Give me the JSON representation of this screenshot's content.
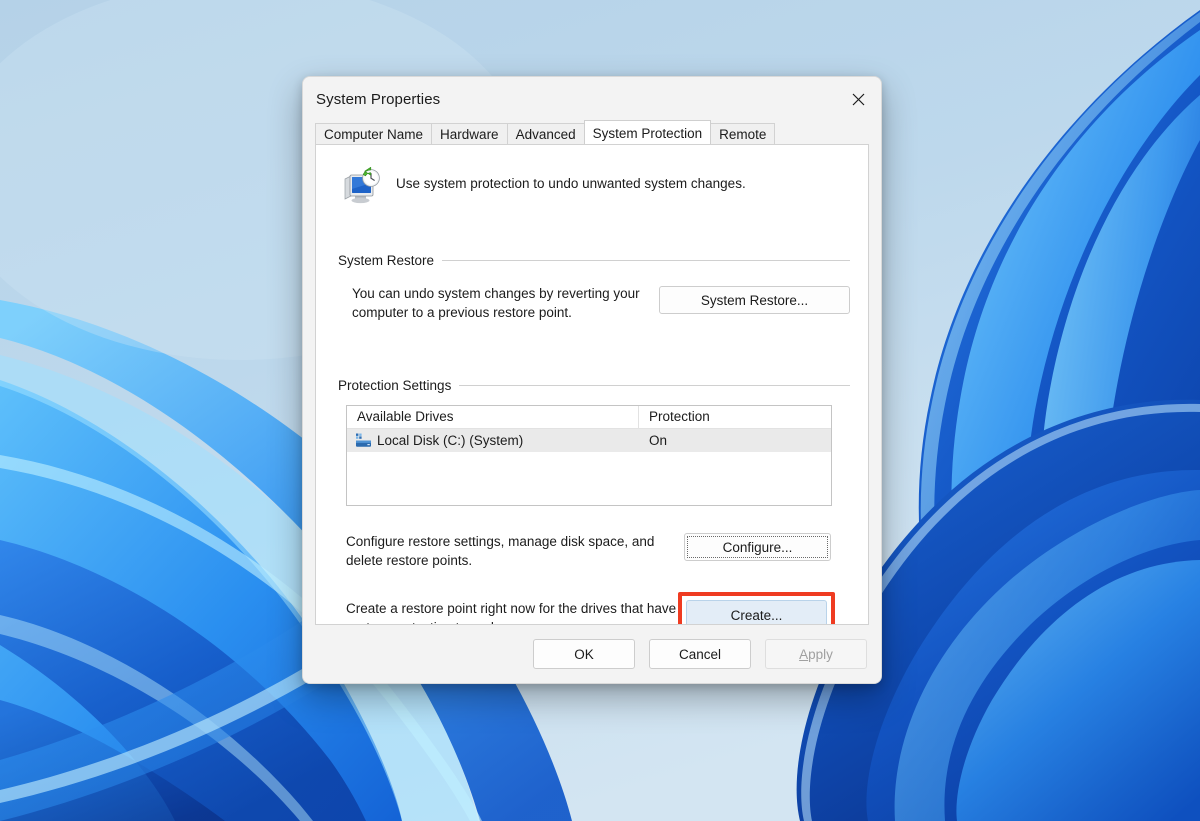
{
  "wallpaper": {
    "name": "windows-11-bloom",
    "base_color": "#b9d5ea"
  },
  "dialog": {
    "title": "System Properties",
    "close_icon": "close-icon",
    "tabs": [
      {
        "label": "Computer Name",
        "active": false
      },
      {
        "label": "Hardware",
        "active": false
      },
      {
        "label": "Advanced",
        "active": false
      },
      {
        "label": "System Protection",
        "active": true
      },
      {
        "label": "Remote",
        "active": false
      }
    ],
    "header": {
      "icon": "system-protection-icon",
      "text": "Use system protection to undo unwanted system changes."
    },
    "system_restore": {
      "group_label": "System Restore",
      "description": "You can undo system changes by reverting your computer to a previous restore point.",
      "button_label": "System Restore..."
    },
    "protection_settings": {
      "group_label": "Protection Settings",
      "table": {
        "columns": [
          "Available Drives",
          "Protection"
        ],
        "rows": [
          {
            "icon": "hard-drive-icon",
            "drive": "Local Disk (C:) (System)",
            "protection": "On",
            "selected": true
          }
        ]
      },
      "configure": {
        "description": "Configure restore settings, manage disk space, and delete restore points.",
        "button_label": "Configure...",
        "focused": true
      },
      "create": {
        "description": "Create a restore point right now for the drives that have system protection turned on.",
        "button_label": "Create...",
        "highlighted": true,
        "highlight_color": "#ef3b21",
        "button_fill": "#e3edf7"
      }
    },
    "footer": {
      "ok_label": "OK",
      "cancel_label": "Cancel",
      "apply_label": "Apply",
      "apply_accel": "A",
      "apply_disabled": true
    }
  }
}
